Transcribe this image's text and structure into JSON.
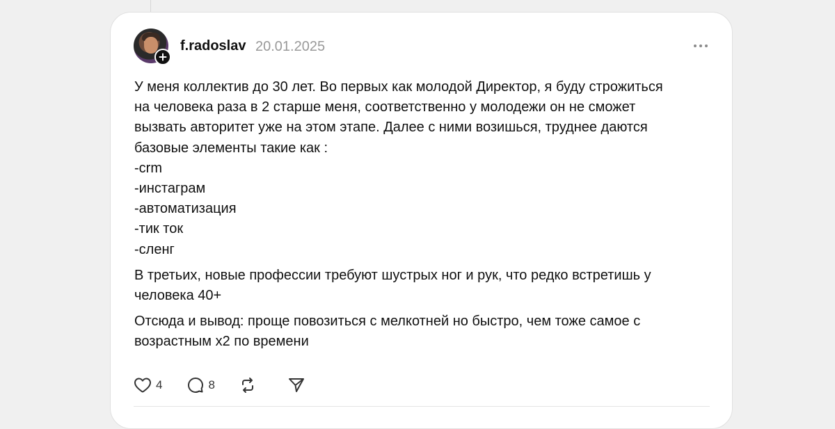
{
  "post": {
    "username": "f.radoslav",
    "date": "20.01.2025",
    "paragraph1": [
      "У меня коллектив до 30 лет. Во первых как молодой Директор, я буду строжиться",
      "на человека раза в 2 старше меня, соответственно у молодежи он не сможет",
      "вызвать авторитет уже на этом этапе. Далее с ними возишься, труднее даются",
      "базовые элементы такие как :",
      "-crm",
      "-инстаграм",
      "-автоматизация",
      "-тик ток",
      "-сленг"
    ],
    "paragraph2": [
      "В третьих, новые профессии требуют шустрых ног и рук, что редко встретишь у",
      "человека 40+"
    ],
    "paragraph3": [
      "Отсюда и вывод: проще повозиться с мелкотней но быстро, чем тоже самое с",
      "возрастным х2 по времени"
    ]
  },
  "actions": {
    "like_count": "4",
    "reply_count": "8",
    "like_icon": "heart-icon",
    "reply_icon": "comment-icon",
    "repost_icon": "repost-icon",
    "share_icon": "send-icon"
  },
  "icons": {
    "more": "more-horizontal-icon",
    "follow": "plus-icon"
  },
  "colors": {
    "text": "#101010",
    "muted": "#999999",
    "card_bg": "#ffffff",
    "page_bg": "#f0f0f0"
  }
}
